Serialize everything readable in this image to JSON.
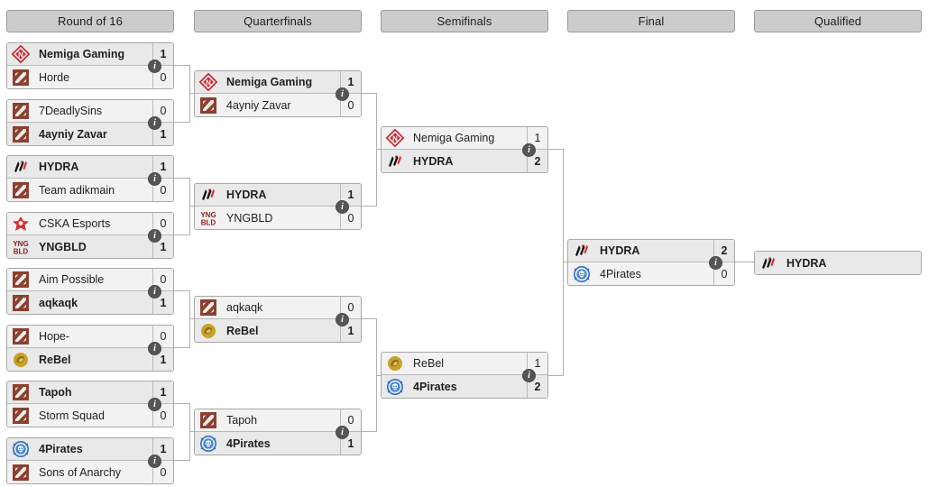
{
  "title": "Tournament Bracket",
  "rounds": [
    {
      "id": "r16",
      "label": "Round of 16"
    },
    {
      "id": "qf",
      "label": "Quarterfinals"
    },
    {
      "id": "sf",
      "label": "Semifinals"
    },
    {
      "id": "f",
      "label": "Final"
    },
    {
      "id": "q",
      "label": "Qualified"
    }
  ],
  "info_icon": "i",
  "colors": {
    "header_bg": "#cccccc",
    "header_border": "#9a9a9a",
    "match_bg": "#f2f2f2",
    "winner_bg": "#e9e9e9",
    "line": "#b0b0b0",
    "nemiga_red": "#cc2027",
    "dota_brown": "#8c4030",
    "hydra_red": "#e8262c",
    "yngbld_red": "#8e1b1b",
    "cska_red": "#d6302b",
    "rebel_gold": "#c9a227",
    "pirates_blue": "#2e6fc4"
  },
  "matches": {
    "r16_1": {
      "top": {
        "team": "Nemiga Gaming",
        "score": "1",
        "logo": "nemiga",
        "winner": true
      },
      "bottom": {
        "team": "Horde",
        "score": "0",
        "logo": "dota",
        "winner": false
      }
    },
    "r16_2": {
      "top": {
        "team": "7DeadlySins",
        "score": "0",
        "logo": "dota",
        "winner": false
      },
      "bottom": {
        "team": "4ayniy Zavar",
        "score": "1",
        "logo": "dota",
        "winner": true
      }
    },
    "r16_3": {
      "top": {
        "team": "HYDRA",
        "score": "1",
        "logo": "hydra",
        "winner": true
      },
      "bottom": {
        "team": "Team adikmain",
        "score": "0",
        "logo": "dota",
        "winner": false
      }
    },
    "r16_4": {
      "top": {
        "team": "CSKA Esports",
        "score": "0",
        "logo": "cska",
        "winner": false
      },
      "bottom": {
        "team": "YNGBLD",
        "score": "1",
        "logo": "yngbld",
        "winner": true
      }
    },
    "r16_5": {
      "top": {
        "team": "Aim Possible",
        "score": "0",
        "logo": "dota",
        "winner": false
      },
      "bottom": {
        "team": "aqkaqk",
        "score": "1",
        "logo": "dota",
        "winner": true
      }
    },
    "r16_6": {
      "top": {
        "team": "Hope-",
        "score": "0",
        "logo": "dota",
        "winner": false
      },
      "bottom": {
        "team": "ReBel",
        "score": "1",
        "logo": "rebel",
        "winner": true
      }
    },
    "r16_7": {
      "top": {
        "team": "Tapoh",
        "score": "1",
        "logo": "dota",
        "winner": true
      },
      "bottom": {
        "team": "Storm Squad",
        "score": "0",
        "logo": "dota",
        "winner": false
      }
    },
    "r16_8": {
      "top": {
        "team": "4Pirates",
        "score": "1",
        "logo": "pirates",
        "winner": true
      },
      "bottom": {
        "team": "Sons of Anarchy",
        "score": "0",
        "logo": "dota",
        "winner": false
      }
    },
    "qf_1": {
      "top": {
        "team": "Nemiga Gaming",
        "score": "1",
        "logo": "nemiga",
        "winner": true
      },
      "bottom": {
        "team": "4ayniy Zavar",
        "score": "0",
        "logo": "dota",
        "winner": false
      }
    },
    "qf_2": {
      "top": {
        "team": "HYDRA",
        "score": "1",
        "logo": "hydra",
        "winner": true
      },
      "bottom": {
        "team": "YNGBLD",
        "score": "0",
        "logo": "yngbld",
        "winner": false
      }
    },
    "qf_3": {
      "top": {
        "team": "aqkaqk",
        "score": "0",
        "logo": "dota",
        "winner": false
      },
      "bottom": {
        "team": "ReBel",
        "score": "1",
        "logo": "rebel",
        "winner": true
      }
    },
    "qf_4": {
      "top": {
        "team": "Tapoh",
        "score": "0",
        "logo": "dota",
        "winner": false
      },
      "bottom": {
        "team": "4Pirates",
        "score": "1",
        "logo": "pirates",
        "winner": true
      }
    },
    "sf_1": {
      "top": {
        "team": "Nemiga Gaming",
        "score": "1",
        "logo": "nemiga",
        "winner": false
      },
      "bottom": {
        "team": "HYDRA",
        "score": "2",
        "logo": "hydra",
        "winner": true
      }
    },
    "sf_2": {
      "top": {
        "team": "ReBel",
        "score": "1",
        "logo": "rebel",
        "winner": false
      },
      "bottom": {
        "team": "4Pirates",
        "score": "2",
        "logo": "pirates",
        "winner": true
      }
    },
    "final": {
      "top": {
        "team": "HYDRA",
        "score": "2",
        "logo": "hydra",
        "winner": true
      },
      "bottom": {
        "team": "4Pirates",
        "score": "0",
        "logo": "pirates",
        "winner": false
      }
    },
    "qualified": {
      "top": {
        "team": "HYDRA",
        "score": "",
        "logo": "hydra",
        "winner": true
      }
    }
  }
}
